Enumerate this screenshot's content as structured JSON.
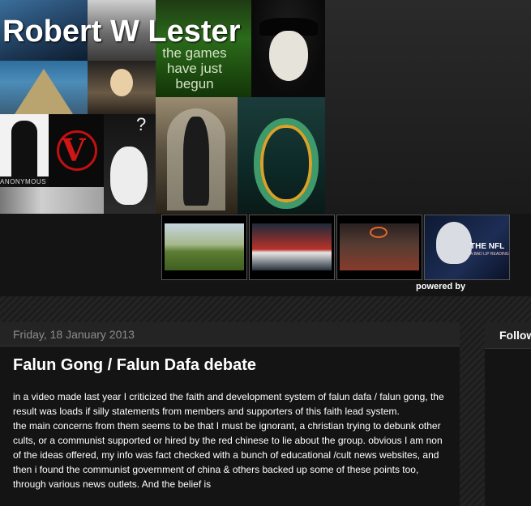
{
  "header": {
    "blog_title": "Robert W Lester",
    "tagline": "the games have just begun",
    "anonymous_label": "ANONYMOUS"
  },
  "thumbnails": {
    "nfl_title": "THE NFL",
    "nfl_subtitle": "A BAD LIP READING"
  },
  "widget": {
    "powered_by": "powered by"
  },
  "post": {
    "date": "Friday, 18 January 2013",
    "title": "Falun Gong / Falun Dafa debate",
    "paragraph_1": "in a video made last year I criticized the faith and development system of falun dafa / falun gong, the result was loads if silly statements from members and supporters of this faith lead system.",
    "paragraph_2": "the main concerns from them seems to be that I must be ignorant, a christian trying to debunk  other cults, or a communist supported or hired by the red chinese to lie about the group.  obvious I am non of the ideas offered, my info was fact checked with a bunch of educational /cult news websites, and then i found the communist government of china & others backed up some of these points too, through various news outlets.  And the belief is"
  },
  "sidebar": {
    "title": "Follow"
  }
}
